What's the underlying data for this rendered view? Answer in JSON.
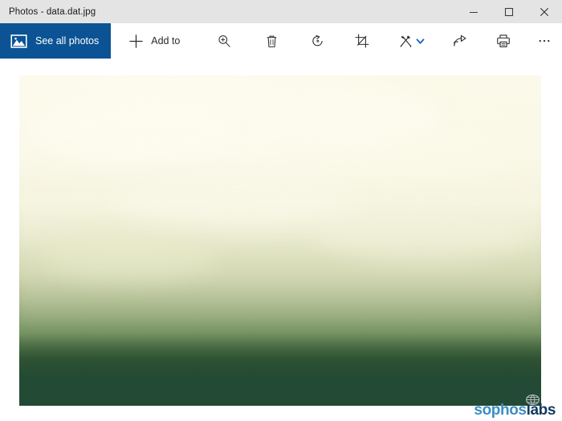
{
  "window": {
    "title": "Photos - data.dat.jpg",
    "controls": [
      {
        "name": "minimize",
        "label": "Minimize",
        "glyph": "minimize-icon"
      },
      {
        "name": "maximize",
        "label": "Maximize",
        "glyph": "maximize-icon"
      },
      {
        "name": "close",
        "label": "Close",
        "glyph": "close-icon"
      }
    ]
  },
  "toolbar": {
    "see_all_photos_label": "See all photos",
    "see_all_photos_icon": "picture-icon",
    "add_to_label": "Add to",
    "add_to_icon": "plus-icon",
    "buttons": [
      {
        "name": "zoom",
        "icon": "zoom-in-icon",
        "label": "Zoom"
      },
      {
        "name": "delete",
        "icon": "trash-icon",
        "label": "Delete"
      },
      {
        "name": "rotate",
        "icon": "rotate-icon",
        "label": "Rotate"
      },
      {
        "name": "crop",
        "icon": "crop-icon",
        "label": "Crop & rotate"
      },
      {
        "name": "enhance",
        "icon": "enhance-icon",
        "label": "Enhance",
        "caret": "chevron-down-icon"
      },
      {
        "name": "share",
        "icon": "share-icon",
        "label": "Share"
      },
      {
        "name": "print",
        "icon": "print-icon",
        "label": "Print"
      },
      {
        "name": "more",
        "icon": "ellipsis-icon",
        "label": "See more"
      }
    ]
  },
  "photo": {
    "alt": "Misty coniferous forest photograph",
    "name": "data.dat.jpg"
  },
  "watermark": {
    "part_one": "sophos",
    "part_two": "labs",
    "icon": "globe-icon"
  },
  "colors": {
    "accent_blue": "#0b5394",
    "titlebar_bg": "#e4e4e4",
    "toolbar_bg": "#ffffff",
    "caret_blue": "#1565c0",
    "photo_band_green": "#234a35",
    "watermark_blue": "#3b8ec4",
    "watermark_navy": "#143a61"
  }
}
